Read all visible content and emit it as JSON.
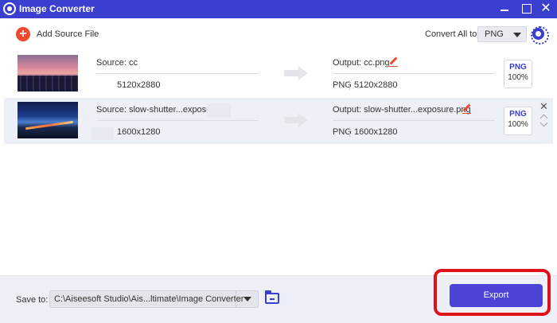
{
  "window": {
    "title": "Image Converter"
  },
  "toolbar": {
    "add_source_label": "Add Source File",
    "convert_all_label": "Convert All to:",
    "convert_all_value": "PNG"
  },
  "files": [
    {
      "source_label": "Source: cc",
      "source_resolution": "5120x2880",
      "output_label": "Output: cc.png",
      "output_format": "PNG",
      "output_resolution": "5120x2880",
      "badge_format": "PNG",
      "badge_quality": "100%"
    },
    {
      "source_label": "Source: slow-shutter...exposure.",
      "source_resolution": "1600x1280",
      "output_label": "Output: slow-shutter...exposure.png",
      "output_format": "PNG",
      "output_resolution": "1600x1280",
      "badge_format": "PNG",
      "badge_quality": "100%"
    }
  ],
  "footer": {
    "save_to_label": "Save to:",
    "save_path": "C:\\Aiseesoft Studio\\Ais...ltimate\\Image Converter",
    "export_label": "Export"
  },
  "colors": {
    "titlebar": "#3a3fcf",
    "accent": "#4b44d6",
    "add_icon": "#ef4a2e",
    "highlight": "#e0111a"
  }
}
